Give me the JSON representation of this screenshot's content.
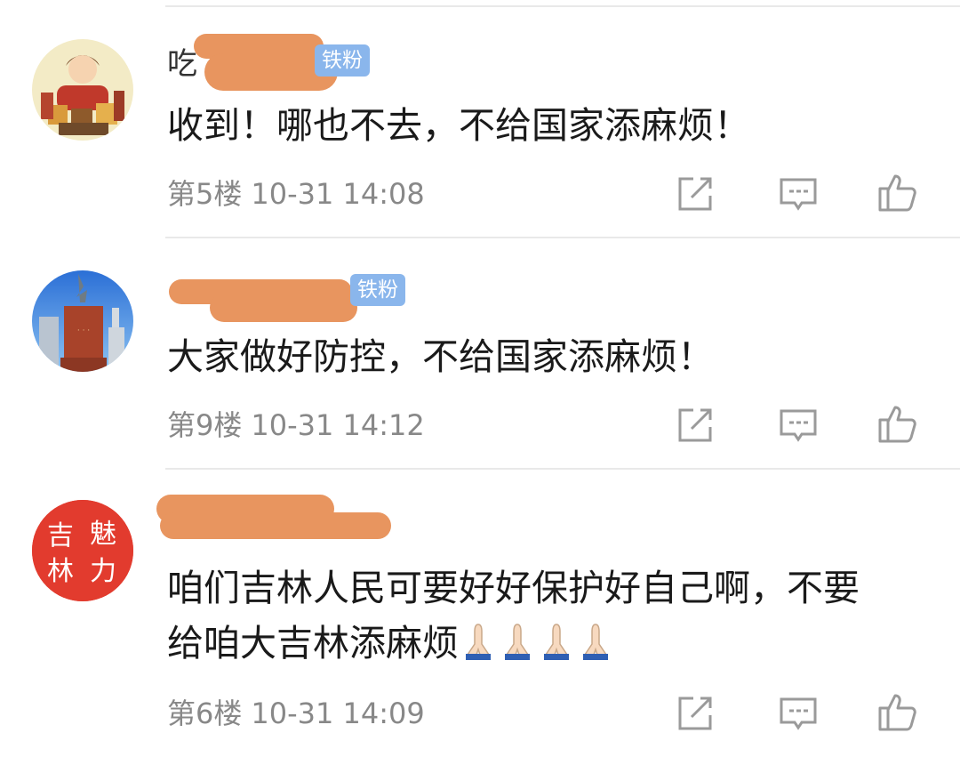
{
  "comments": [
    {
      "username_visible": "吃",
      "badge": "铁粉",
      "text": "收到！哪也不去，不给国家添麻烦！",
      "floor": "第5楼",
      "time": "10-31 14:08"
    },
    {
      "username_visible": "",
      "badge": "铁粉",
      "text": "大家做好防控，不给国家添麻烦！",
      "floor": "第9楼",
      "time": "10-31 14:12"
    },
    {
      "username_visible": "",
      "badge": "",
      "text_line1": "咱们吉林人民可要好好保护好自己啊，不要",
      "text_line2": "给咱大吉林添麻烦",
      "emoji": [
        "folded-hands",
        "folded-hands",
        "folded-hands",
        "folded-hands"
      ],
      "floor": "第6楼",
      "time": "10-31 14:09",
      "avatar_text": [
        "吉",
        "魅",
        "林",
        "力"
      ]
    }
  ],
  "icons": {
    "share": "share-edit-icon",
    "reply": "comment-icon",
    "like": "thumbs-up-icon"
  },
  "colors": {
    "badge": "#8ab6ec",
    "redaction": "#e8955f",
    "avatar_red": "#e23b2e",
    "meta_text": "#888888"
  }
}
